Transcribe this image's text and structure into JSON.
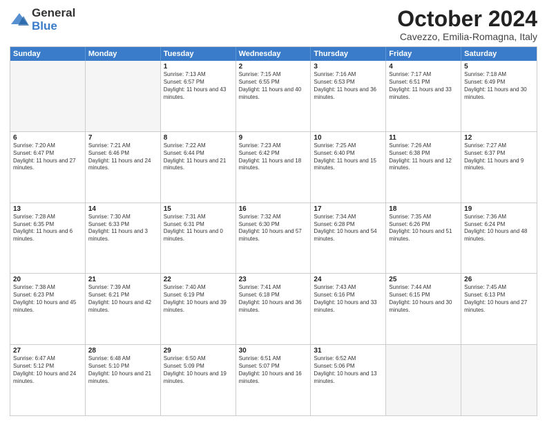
{
  "logo": {
    "general": "General",
    "blue": "Blue"
  },
  "header": {
    "month": "October 2024",
    "location": "Cavezzo, Emilia-Romagna, Italy"
  },
  "days": [
    "Sunday",
    "Monday",
    "Tuesday",
    "Wednesday",
    "Thursday",
    "Friday",
    "Saturday"
  ],
  "weeks": [
    [
      {
        "day": "",
        "info": "",
        "empty": true
      },
      {
        "day": "",
        "info": "",
        "empty": true
      },
      {
        "day": "1",
        "info": "Sunrise: 7:13 AM\nSunset: 6:57 PM\nDaylight: 11 hours and 43 minutes.",
        "empty": false
      },
      {
        "day": "2",
        "info": "Sunrise: 7:15 AM\nSunset: 6:55 PM\nDaylight: 11 hours and 40 minutes.",
        "empty": false
      },
      {
        "day": "3",
        "info": "Sunrise: 7:16 AM\nSunset: 6:53 PM\nDaylight: 11 hours and 36 minutes.",
        "empty": false
      },
      {
        "day": "4",
        "info": "Sunrise: 7:17 AM\nSunset: 6:51 PM\nDaylight: 11 hours and 33 minutes.",
        "empty": false
      },
      {
        "day": "5",
        "info": "Sunrise: 7:18 AM\nSunset: 6:49 PM\nDaylight: 11 hours and 30 minutes.",
        "empty": false
      }
    ],
    [
      {
        "day": "6",
        "info": "Sunrise: 7:20 AM\nSunset: 6:47 PM\nDaylight: 11 hours and 27 minutes.",
        "empty": false
      },
      {
        "day": "7",
        "info": "Sunrise: 7:21 AM\nSunset: 6:46 PM\nDaylight: 11 hours and 24 minutes.",
        "empty": false
      },
      {
        "day": "8",
        "info": "Sunrise: 7:22 AM\nSunset: 6:44 PM\nDaylight: 11 hours and 21 minutes.",
        "empty": false
      },
      {
        "day": "9",
        "info": "Sunrise: 7:23 AM\nSunset: 6:42 PM\nDaylight: 11 hours and 18 minutes.",
        "empty": false
      },
      {
        "day": "10",
        "info": "Sunrise: 7:25 AM\nSunset: 6:40 PM\nDaylight: 11 hours and 15 minutes.",
        "empty": false
      },
      {
        "day": "11",
        "info": "Sunrise: 7:26 AM\nSunset: 6:38 PM\nDaylight: 11 hours and 12 minutes.",
        "empty": false
      },
      {
        "day": "12",
        "info": "Sunrise: 7:27 AM\nSunset: 6:37 PM\nDaylight: 11 hours and 9 minutes.",
        "empty": false
      }
    ],
    [
      {
        "day": "13",
        "info": "Sunrise: 7:28 AM\nSunset: 6:35 PM\nDaylight: 11 hours and 6 minutes.",
        "empty": false
      },
      {
        "day": "14",
        "info": "Sunrise: 7:30 AM\nSunset: 6:33 PM\nDaylight: 11 hours and 3 minutes.",
        "empty": false
      },
      {
        "day": "15",
        "info": "Sunrise: 7:31 AM\nSunset: 6:31 PM\nDaylight: 11 hours and 0 minutes.",
        "empty": false
      },
      {
        "day": "16",
        "info": "Sunrise: 7:32 AM\nSunset: 6:30 PM\nDaylight: 10 hours and 57 minutes.",
        "empty": false
      },
      {
        "day": "17",
        "info": "Sunrise: 7:34 AM\nSunset: 6:28 PM\nDaylight: 10 hours and 54 minutes.",
        "empty": false
      },
      {
        "day": "18",
        "info": "Sunrise: 7:35 AM\nSunset: 6:26 PM\nDaylight: 10 hours and 51 minutes.",
        "empty": false
      },
      {
        "day": "19",
        "info": "Sunrise: 7:36 AM\nSunset: 6:24 PM\nDaylight: 10 hours and 48 minutes.",
        "empty": false
      }
    ],
    [
      {
        "day": "20",
        "info": "Sunrise: 7:38 AM\nSunset: 6:23 PM\nDaylight: 10 hours and 45 minutes.",
        "empty": false
      },
      {
        "day": "21",
        "info": "Sunrise: 7:39 AM\nSunset: 6:21 PM\nDaylight: 10 hours and 42 minutes.",
        "empty": false
      },
      {
        "day": "22",
        "info": "Sunrise: 7:40 AM\nSunset: 6:19 PM\nDaylight: 10 hours and 39 minutes.",
        "empty": false
      },
      {
        "day": "23",
        "info": "Sunrise: 7:41 AM\nSunset: 6:18 PM\nDaylight: 10 hours and 36 minutes.",
        "empty": false
      },
      {
        "day": "24",
        "info": "Sunrise: 7:43 AM\nSunset: 6:16 PM\nDaylight: 10 hours and 33 minutes.",
        "empty": false
      },
      {
        "day": "25",
        "info": "Sunrise: 7:44 AM\nSunset: 6:15 PM\nDaylight: 10 hours and 30 minutes.",
        "empty": false
      },
      {
        "day": "26",
        "info": "Sunrise: 7:45 AM\nSunset: 6:13 PM\nDaylight: 10 hours and 27 minutes.",
        "empty": false
      }
    ],
    [
      {
        "day": "27",
        "info": "Sunrise: 6:47 AM\nSunset: 5:12 PM\nDaylight: 10 hours and 24 minutes.",
        "empty": false
      },
      {
        "day": "28",
        "info": "Sunrise: 6:48 AM\nSunset: 5:10 PM\nDaylight: 10 hours and 21 minutes.",
        "empty": false
      },
      {
        "day": "29",
        "info": "Sunrise: 6:50 AM\nSunset: 5:09 PM\nDaylight: 10 hours and 19 minutes.",
        "empty": false
      },
      {
        "day": "30",
        "info": "Sunrise: 6:51 AM\nSunset: 5:07 PM\nDaylight: 10 hours and 16 minutes.",
        "empty": false
      },
      {
        "day": "31",
        "info": "Sunrise: 6:52 AM\nSunset: 5:06 PM\nDaylight: 10 hours and 13 minutes.",
        "empty": false
      },
      {
        "day": "",
        "info": "",
        "empty": true
      },
      {
        "day": "",
        "info": "",
        "empty": true
      }
    ]
  ]
}
